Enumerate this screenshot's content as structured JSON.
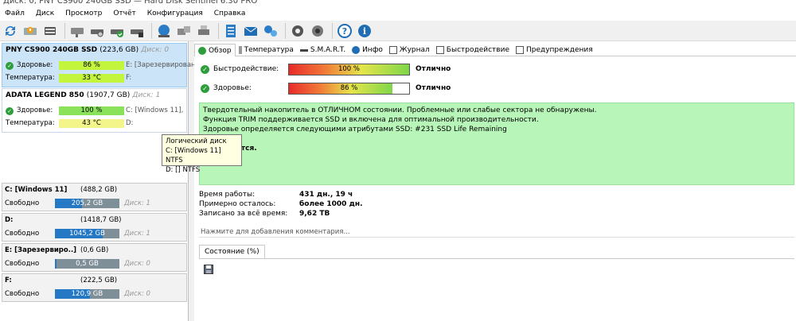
{
  "menu": [
    "Файл",
    "Диск",
    "Просмотр",
    "Отчёт",
    "Конфигурация",
    "Справка"
  ],
  "disks": [
    {
      "name": "PNY CS900 240GB SSD",
      "size": "(223,6 GB)",
      "disk_no": "Диск: 0",
      "health_label": "Здоровье:",
      "health_value": "86 %",
      "health_side": "E: [Зарезервирован",
      "temp_label": "Температура:",
      "temp_value": "33 °C",
      "temp_side": "F:"
    },
    {
      "name": "ADATA LEGEND 850",
      "size": "(1907,7 GB)",
      "disk_no": "Диск: 1",
      "health_label": "Здоровье:",
      "health_value": "100 %",
      "health_side": "C: [Windows 11],",
      "temp_label": "Температура:",
      "temp_value": "43 °C",
      "temp_side": "D:"
    }
  ],
  "tooltip": {
    "title": "Логический диск",
    "line1": "C: [Windows 11] NTFS",
    "line2": "D: [] NTFS"
  },
  "volumes": [
    {
      "title": "C: [Windows 11]",
      "size": "(488,2 GB)",
      "free_label": "Свободно",
      "free": "205,2 GB",
      "free_fraction": 0.42,
      "disk": "Диск: 1"
    },
    {
      "title": "D:",
      "size": "(1418,7 GB)",
      "free_label": "Свободно",
      "free": "1045,2 GB",
      "free_fraction": 0.74,
      "disk": "Диск: 1"
    },
    {
      "title": "E: [Зарезервиро..]",
      "size": "(0,6 GB)",
      "free_label": "Свободно",
      "free": "0,5 GB",
      "free_fraction": 0.03,
      "disk": "Диск: 0"
    },
    {
      "title": "F:",
      "size": "(222,5 GB)",
      "free_label": "Свободно",
      "free": "120,9 GB",
      "free_fraction": 0.54,
      "disk": "Диск: 0"
    }
  ],
  "tabs": [
    "Обзор",
    "Температура",
    "S.M.A.R.T.",
    "Инфо",
    "Журнал",
    "Быстродействие",
    "Предупреждения"
  ],
  "performance": {
    "label": "Быстродействие:",
    "value": "100 %",
    "fraction": 1.0,
    "result": "Отлично"
  },
  "health": {
    "label": "Здоровье:",
    "value": "86 %",
    "fraction": 0.86,
    "result": "Отлично"
  },
  "description": {
    "line1": "Твердотельный накопитель в ОТЛИЧНОМ состоянии. Проблемные или слабые сектора не обнаружены.",
    "line2": "Функция TRIM поддерживается SSD и включена для оптимальной производительности.",
    "line3": "Здоровье определяется следующими атрибутами SSD: #231 SSD Life Remaining",
    "line4": "е требуются."
  },
  "stats": [
    {
      "key": "Время работы:",
      "value": "431 дн., 19 ч"
    },
    {
      "key": "Примерно осталось:",
      "value": "более 1000 дн."
    },
    {
      "key": "Записано за всё время:",
      "value": "9,62 TB"
    }
  ],
  "comment_placeholder": "Нажмите для добавления комментария...",
  "subtab": "Состояние (%)",
  "colors": {
    "selected_disk": "#cce4f7",
    "green_box": "#b8f5b8",
    "volume_bar": "#2478c4"
  }
}
